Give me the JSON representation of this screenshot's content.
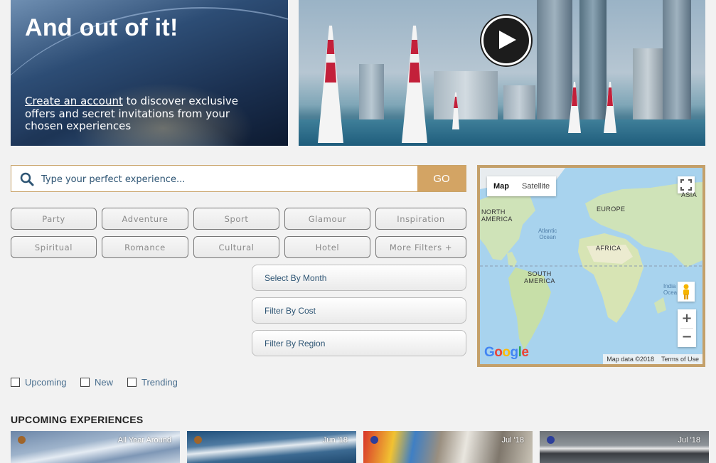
{
  "hero": {
    "title": "And out of it!",
    "cta_link": "Create an account",
    "cta_text": " to discover exclusive offers and secret invitations from your chosen experiences"
  },
  "video": {
    "play_icon": "play-icon"
  },
  "search": {
    "placeholder": "Type your perfect experience...",
    "button_label": "GO",
    "icon": "search-icon"
  },
  "categories": [
    "Party",
    "Adventure",
    "Sport",
    "Glamour",
    "Inspiration",
    "Spiritual",
    "Romance",
    "Cultural",
    "Hotel",
    "More Filters +"
  ],
  "filters": [
    "Select By Month",
    "Filter By Cost",
    "Filter By Region"
  ],
  "checkboxes": [
    "Upcoming",
    "New",
    "Trending"
  ],
  "map": {
    "type_map": "Map",
    "type_satellite": "Satellite",
    "labels": {
      "north_america": "NORTH\nAMERICA",
      "europe": "EUROPE",
      "asia": "ASIA",
      "africa": "AFRICA",
      "south_america": "SOUTH\nAMERICA",
      "atlantic": "Atlantic\nOcean",
      "indian": "India\nOcea"
    },
    "zoom_in": "+",
    "zoom_out": "−",
    "logo": "Google",
    "attribution": "Map data ©2018",
    "terms": "Terms of Use"
  },
  "upcoming": {
    "title": "UPCOMING EXPERIENCES",
    "cards": [
      {
        "date": "All Year Around",
        "dot_color": "#a0652a"
      },
      {
        "date": "Jun '18",
        "dot_color": "#a0652a"
      },
      {
        "date": "Jul '18",
        "dot_color": "#2c3e9a"
      },
      {
        "date": "Jul '18",
        "dot_color": "#2c3e9a"
      }
    ]
  },
  "colors": {
    "accent": "#d3a464",
    "link": "#2e5574",
    "map_border": "#c4a06a"
  }
}
